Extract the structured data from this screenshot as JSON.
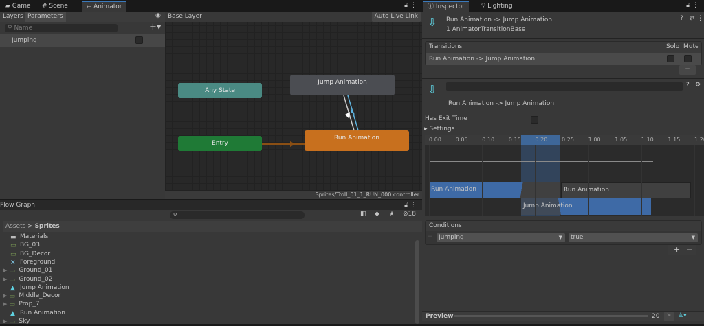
{
  "left_tabs": [
    {
      "label": "Game",
      "icon": "gamepad-icon"
    },
    {
      "label": "Scene",
      "icon": "grid-icon"
    },
    {
      "label": "Animator",
      "icon": "animator-icon"
    }
  ],
  "animator": {
    "sub_tabs": [
      "Layers",
      "Parameters"
    ],
    "search_placeholder": "Name",
    "parameters": [
      {
        "name": "Jumping",
        "value": false
      }
    ],
    "breadcrumb": "Base Layer",
    "auto_live_link": "Auto Live Link",
    "nodes": {
      "any_state": "Any State",
      "entry": "Entry",
      "jump": "Jump Animation",
      "run": "Run Animation"
    },
    "footer_path": "Sprites/Troll_01_1_RUN_000.controller",
    "colors": {
      "any_state": "#4a8a83",
      "entry": "#1f7a36",
      "run": "#c8701e",
      "jump": "#4b4d52",
      "transition": "#5fb4e0"
    }
  },
  "project": {
    "title": "Flow Graph",
    "hidden_count": "18",
    "breadcrumb": [
      "Assets",
      "Sprites"
    ],
    "items": [
      {
        "label": "Materials",
        "icon": "folder-icon",
        "expandable": false
      },
      {
        "label": "BG_03",
        "icon": "sprite-icon",
        "expandable": false
      },
      {
        "label": "BG_Decor",
        "icon": "sprite-icon",
        "expandable": false
      },
      {
        "label": "Foreground",
        "icon": "prefab-icon",
        "expandable": false
      },
      {
        "label": "Ground_01",
        "icon": "sprite-icon",
        "expandable": true
      },
      {
        "label": "Ground_02",
        "icon": "sprite-icon",
        "expandable": true
      },
      {
        "label": "Jump Animation",
        "icon": "animation-clip-icon",
        "expandable": false
      },
      {
        "label": "Middle_Decor",
        "icon": "sprite-icon",
        "expandable": true
      },
      {
        "label": "Prop_7",
        "icon": "sprite-icon",
        "expandable": true
      },
      {
        "label": "Run Animation",
        "icon": "animation-clip-icon",
        "expandable": false
      },
      {
        "label": "Sky",
        "icon": "sprite-icon",
        "expandable": true
      }
    ]
  },
  "inspector": {
    "tabs": [
      "Inspector",
      "Lighting"
    ],
    "title": "Run Animation -> Jump Animation",
    "subtitle": "1 AnimatorTransitionBase",
    "transitions_header": "Transitions",
    "solo": "Solo",
    "mute": "Mute",
    "transition_row": "Run Animation -> Jump Animation",
    "name_value": "",
    "transition_label": "Run Animation -> Jump Animation",
    "has_exit_time_label": "Has Exit Time",
    "has_exit_time": false,
    "settings_label": "Settings",
    "timeline": {
      "ticks": [
        "0:00",
        "0:05",
        "0:10",
        "0:15",
        "0:20",
        "0:25",
        "1:00",
        "1:05",
        "1:10",
        "1:15",
        "1:20"
      ],
      "clip_a": "Run Animation",
      "clip_a_next": "Run Animation",
      "clip_b": "Jump Animation"
    },
    "conditions_label": "Conditions",
    "condition": {
      "parameter": "Jumping",
      "value": "true"
    },
    "preview_label": "Preview",
    "preview_speed": "20"
  }
}
